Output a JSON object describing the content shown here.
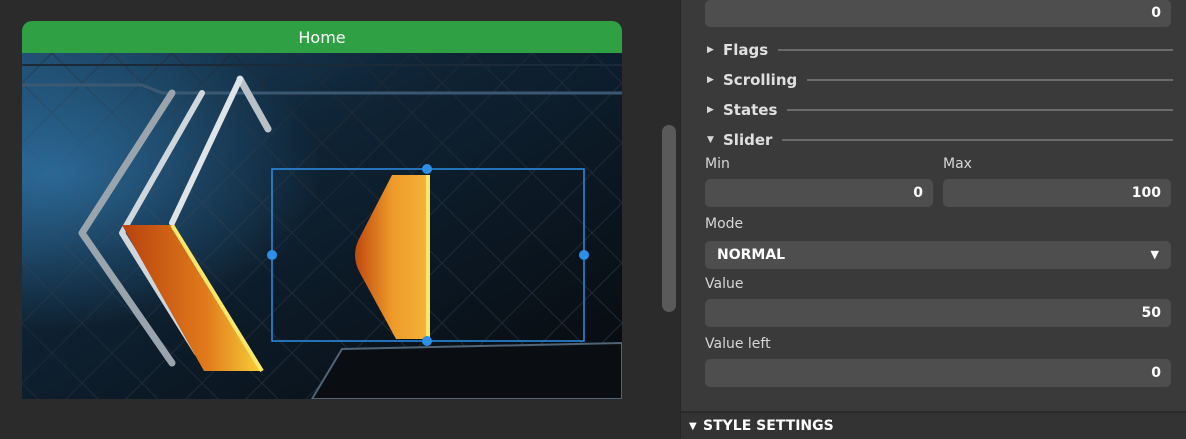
{
  "screen": {
    "title": "Home"
  },
  "panel": {
    "top_field_value": "0",
    "sections": {
      "flags": "Flags",
      "scrolling": "Scrolling",
      "states": "States",
      "slider": "Slider"
    },
    "slider": {
      "min_label": "Min",
      "min_value": "0",
      "max_label": "Max",
      "max_value": "100",
      "mode_label": "Mode",
      "mode_value": "NORMAL",
      "value_label": "Value",
      "value": "50",
      "value_left_label": "Value left",
      "value_left": "0"
    },
    "style_settings": "STYLE SETTINGS"
  },
  "colors": {
    "titlebar": "#2fa043",
    "selection": "#2d8fe8",
    "orange": "#f0a02a",
    "field_bg": "#4e4e4e",
    "panel_bg": "#3a3a3a"
  }
}
